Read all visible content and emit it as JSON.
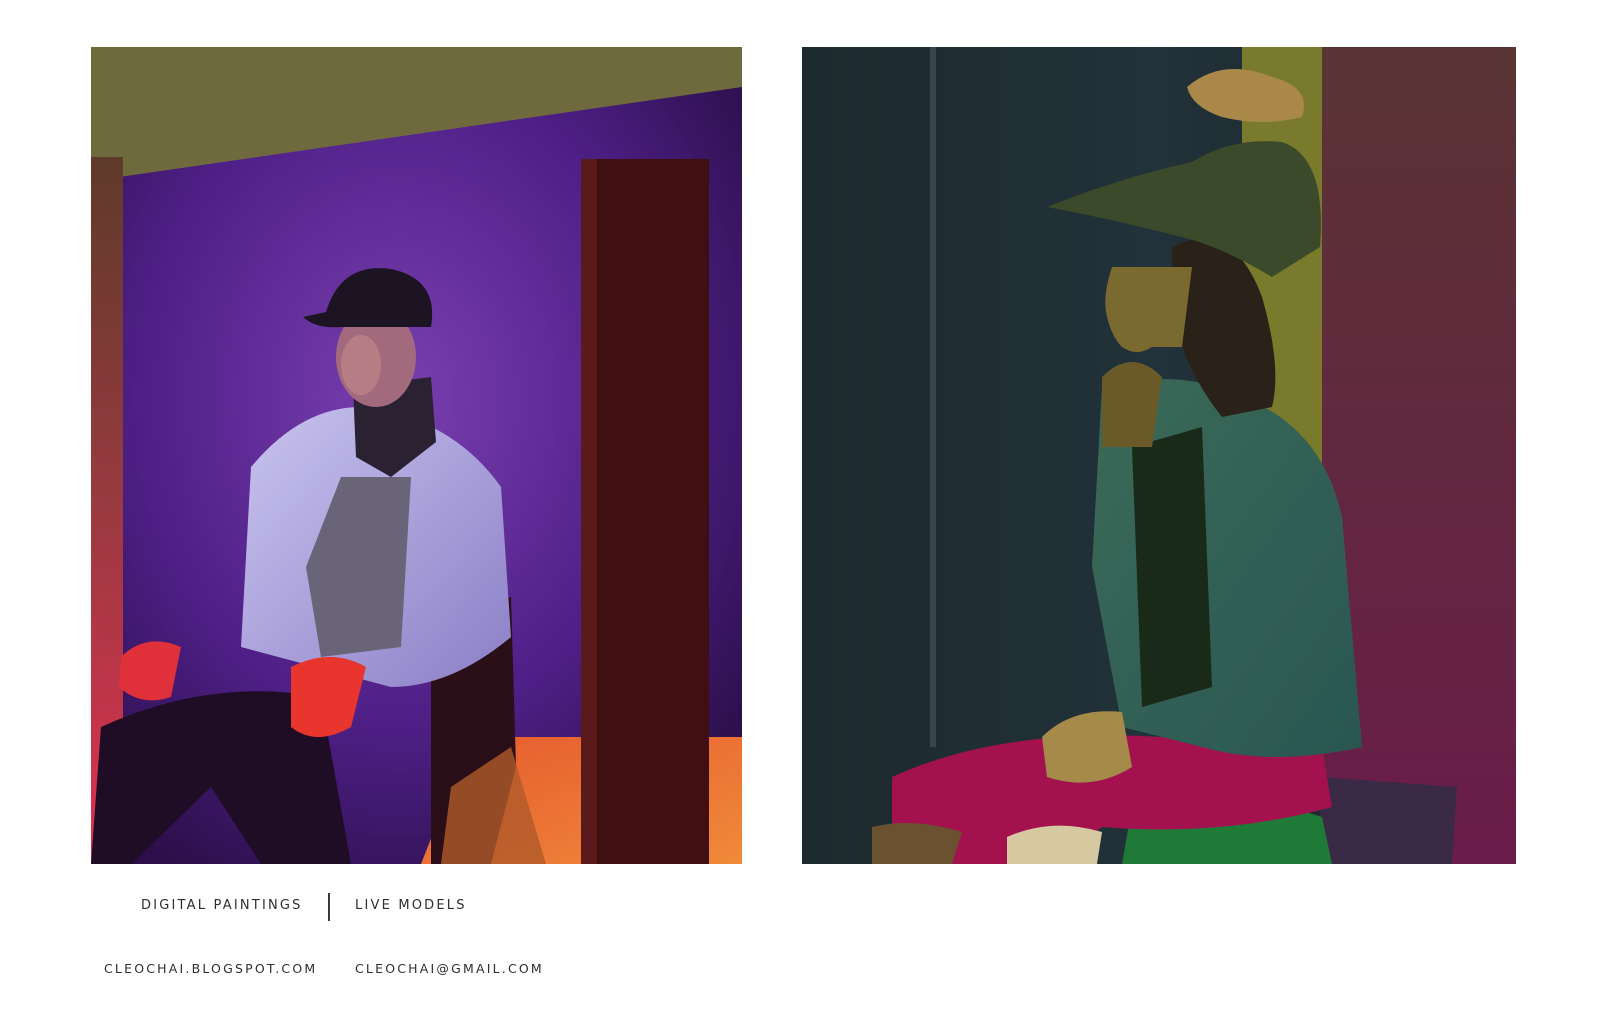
{
  "captions": {
    "category": "DIGITAL PAINTINGS",
    "subject": "LIVE MODELS"
  },
  "contact": {
    "blog": "CLEOCHAI.BLOGSPOT.COM",
    "email": "CLEOCHAI@GMAIL.COM"
  }
}
